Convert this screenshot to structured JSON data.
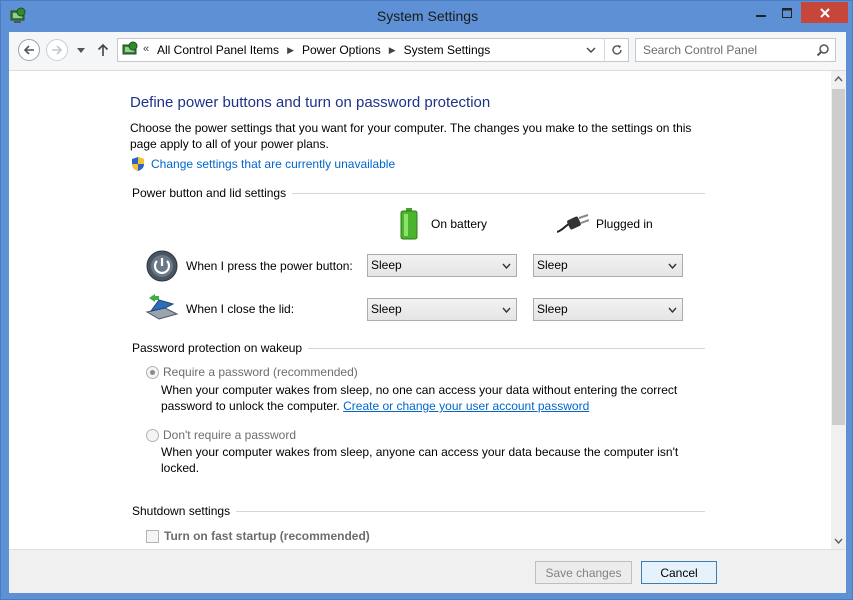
{
  "window": {
    "title": "System Settings"
  },
  "address": {
    "crumbs": [
      "All Control Panel Items",
      "Power Options",
      "System Settings"
    ],
    "overflow_glyph": "«"
  },
  "search": {
    "placeholder": "Search Control Panel"
  },
  "page": {
    "heading": "Define power buttons and turn on password protection",
    "description": "Choose the power settings that you want for your computer. The changes you make to the settings on this page apply to all of your power plans.",
    "change_settings_link": "Change settings that are currently unavailable"
  },
  "power_section": {
    "title": "Power button and lid settings",
    "on_battery": "On battery",
    "plugged_in": "Plugged in",
    "rows": [
      {
        "label": "When I press the power button:",
        "battery": "Sleep",
        "plugged": "Sleep"
      },
      {
        "label": "When I close the lid:",
        "battery": "Sleep",
        "plugged": "Sleep"
      }
    ]
  },
  "password_section": {
    "title": "Password protection on wakeup",
    "require": {
      "label": "Require a password (recommended)",
      "desc_prefix": "When your computer wakes from sleep, no one can access your data without entering the correct password to unlock the computer. ",
      "link": "Create or change your user account password",
      "checked": true
    },
    "dont_require": {
      "label": "Don't require a password",
      "desc": "When your computer wakes from sleep, anyone can access your data because the computer isn't locked.",
      "checked": false
    }
  },
  "shutdown_section": {
    "title": "Shutdown settings",
    "fast_startup": "Turn on fast startup (recommended)"
  },
  "footer": {
    "save": "Save changes",
    "cancel": "Cancel"
  },
  "colors": {
    "titlebar": "#5e90d6",
    "close": "#c7463a",
    "heading": "#1e3287",
    "link": "#0066cc"
  },
  "icons": [
    "control-panel-icon",
    "back-arrow-icon",
    "forward-arrow-icon",
    "up-arrow-icon",
    "refresh-icon",
    "search-icon",
    "shield-icon",
    "battery-icon",
    "plug-icon",
    "power-button-icon",
    "laptop-lid-icon"
  ]
}
